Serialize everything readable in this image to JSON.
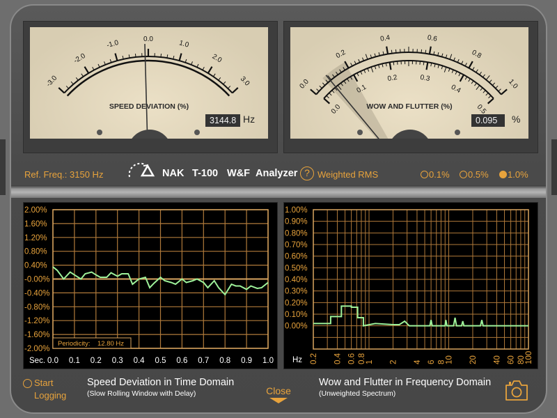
{
  "speed_meter": {
    "title": "SPEED DEVIATION (%)",
    "scale_labels": [
      "-3.0",
      "-2.0",
      "-1.0",
      "0.0",
      "1.0",
      "2.0",
      "3.0"
    ],
    "scale_range": [
      -3.0,
      3.0
    ],
    "needle_value": -0.1,
    "readout": "3144.8",
    "unit": "Hz"
  },
  "wf_meter": {
    "title": "WOW AND FLUTTER (%)",
    "outer_scale_labels": [
      "0.0",
      "0.2",
      "0.4",
      "0.6",
      "0.8",
      "1.0"
    ],
    "inner_scale_labels": [
      "0.0",
      "0.1",
      "0.2",
      "0.3",
      "0.4",
      "0.5"
    ],
    "needle_value": 0.095,
    "readout": "0.095",
    "unit": "%"
  },
  "info_bar": {
    "ref_freq": "Ref. Freq.: 3150 Hz",
    "brand": [
      "NAK",
      "T-100",
      "W&F",
      "Analyzer"
    ],
    "help_icon": "question-circle-icon",
    "help_label": "?",
    "mode": "Weighted RMS",
    "ranges": [
      {
        "label": "0.1%",
        "selected": false
      },
      {
        "label": "0.5%",
        "selected": false
      },
      {
        "label": "1.0%",
        "selected": true
      }
    ]
  },
  "footer": {
    "logging_label_1": "Start",
    "logging_label_2": "Logging",
    "left_title": "Speed Deviation in Time Domain",
    "left_subtitle": "(Slow Rolling Window with Delay)",
    "close_label": "Close",
    "right_title": "Wow and Flutter in Frequency Domain",
    "right_subtitle": "(Unweighted Spectrum)",
    "camera_icon": "camera-icon"
  },
  "colors": {
    "accent": "#e8a33c",
    "trace": "#9ef29a",
    "grid": "#b07a3a",
    "meter_face": "#e3d8bd"
  },
  "chart_data": [
    {
      "type": "line",
      "xlabel": "Sec.",
      "xlim": [
        0,
        1.0
      ],
      "ylim": [
        -2.0,
        2.0
      ],
      "x_ticks": [
        "0.0",
        "0.1",
        "0.2",
        "0.3",
        "0.4",
        "0.5",
        "0.6",
        "0.7",
        "0.8",
        "0.9",
        "1.0"
      ],
      "y_ticks": [
        "2.00%",
        "1.60%",
        "1.20%",
        "0.80%",
        "0.40%",
        "-0.00%",
        "-0.40%",
        "-0.80%",
        "-1.20%",
        "-1.60%",
        "-2.00%"
      ],
      "grid": true,
      "annotation_label": "Periodicity:",
      "annotation_value": "12.80 Hz",
      "x": [
        0,
        0.02,
        0.05,
        0.08,
        0.1,
        0.13,
        0.15,
        0.18,
        0.2,
        0.22,
        0.25,
        0.27,
        0.3,
        0.32,
        0.35,
        0.37,
        0.4,
        0.43,
        0.45,
        0.47,
        0.5,
        0.52,
        0.55,
        0.57,
        0.6,
        0.62,
        0.65,
        0.67,
        0.7,
        0.72,
        0.75,
        0.77,
        0.8,
        0.83,
        0.85,
        0.87,
        0.9,
        0.92,
        0.95,
        0.97,
        1.0
      ],
      "y": [
        0.35,
        0.25,
        0.0,
        0.2,
        0.12,
        0.0,
        0.15,
        0.2,
        0.12,
        0.05,
        0.05,
        0.18,
        0.08,
        0.15,
        0.15,
        -0.15,
        0.0,
        0.05,
        -0.25,
        -0.12,
        0.05,
        -0.05,
        -0.1,
        -0.15,
        0.0,
        -0.1,
        -0.05,
        0.0,
        -0.1,
        -0.25,
        -0.05,
        -0.25,
        -0.45,
        -0.15,
        -0.2,
        -0.2,
        -0.3,
        -0.2,
        -0.27,
        -0.25,
        -0.1
      ]
    },
    {
      "type": "line",
      "xlabel": "Hz",
      "x_scale": "log",
      "xlim": [
        0.2,
        100
      ],
      "ylim": [
        -0.2,
        1.0
      ],
      "x_ticks": [
        "0.2",
        "0.4",
        "0.6",
        "0.8",
        "1",
        "2",
        "4",
        "6",
        "8",
        "10",
        "20",
        "40",
        "60",
        "80",
        "100"
      ],
      "y_ticks": [
        "1.00%",
        "0.90%",
        "0.80%",
        "0.70%",
        "0.60%",
        "0.50%",
        "0.40%",
        "0.30%",
        "0.20%",
        "0.10%",
        "0.00%"
      ],
      "grid": true,
      "x": [
        0.2,
        0.33,
        0.33,
        0.45,
        0.45,
        0.6,
        0.6,
        0.72,
        0.72,
        0.85,
        0.85,
        1.2,
        2.0,
        2.4,
        2.8,
        3.2,
        5.8,
        6,
        6.2,
        9,
        9.2,
        9.5,
        11.5,
        12,
        12.5,
        14.5,
        15,
        15.5,
        25,
        26,
        27,
        100
      ],
      "y": [
        0.02,
        0.02,
        0.08,
        0.08,
        0.17,
        0.17,
        0.16,
        0.16,
        0.07,
        0.07,
        0.0,
        0.02,
        0.01,
        0.01,
        0.04,
        0.0,
        0.0,
        0.05,
        0.0,
        0.0,
        0.05,
        0.0,
        0.0,
        0.07,
        0.0,
        0.0,
        0.04,
        0.0,
        0.0,
        0.05,
        0.0,
        0.0
      ]
    }
  ]
}
